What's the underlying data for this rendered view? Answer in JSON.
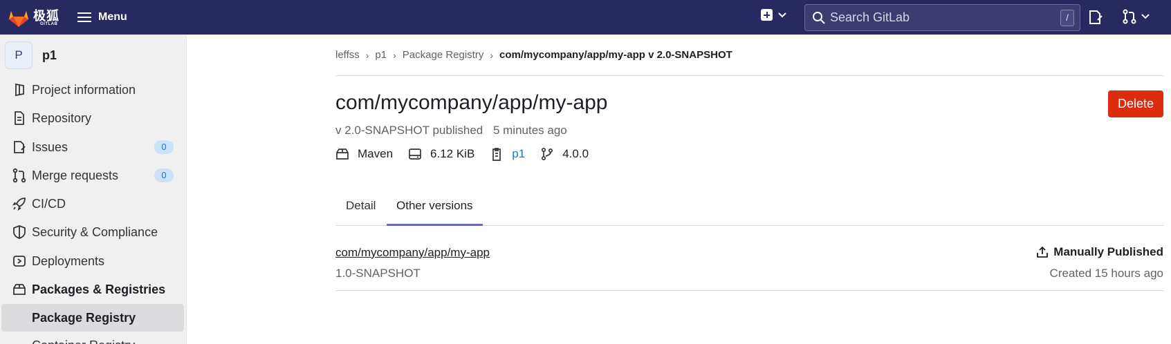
{
  "topbar": {
    "logo_text": "极狐",
    "logo_sub": "GITLAB",
    "menu_label": "Menu",
    "search_placeholder": "Search GitLab",
    "search_shortcut": "/",
    "color": "#292961"
  },
  "sidebar": {
    "project_avatar": "P",
    "project_name": "p1",
    "items": [
      {
        "label": "Project information",
        "icon": "project-icon"
      },
      {
        "label": "Repository",
        "icon": "document-icon"
      },
      {
        "label": "Issues",
        "icon": "issues-icon",
        "badge": "0"
      },
      {
        "label": "Merge requests",
        "icon": "merge-request-icon",
        "badge": "0"
      },
      {
        "label": "CI/CD",
        "icon": "rocket-icon"
      },
      {
        "label": "Security & Compliance",
        "icon": "shield-icon"
      },
      {
        "label": "Deployments",
        "icon": "deployments-icon"
      },
      {
        "label": "Packages & Registries",
        "icon": "package-icon"
      },
      {
        "label": "Package Registry"
      },
      {
        "label": "Container Registry"
      }
    ]
  },
  "breadcrumb": {
    "items": [
      "leffss",
      "p1",
      "Package Registry",
      "com/mycompany/app/my-app v 2.0-SNAPSHOT"
    ]
  },
  "package": {
    "title": "com/mycompany/app/my-app",
    "delete_label": "Delete",
    "version_published": "v 2.0-SNAPSHOT published",
    "time_ago": "5 minutes ago",
    "type": "Maven",
    "size": "6.12 KiB",
    "project": "p1",
    "pipeline_ref": "4.0.0"
  },
  "tabs": {
    "detail": "Detail",
    "other_versions": "Other versions"
  },
  "versions": [
    {
      "name": "com/mycompany/app/my-app",
      "version": "1.0-SNAPSHOT",
      "status": "Manually Published",
      "created": "Created 15 hours ago"
    }
  ],
  "colors": {
    "delete": "#dd2b0e",
    "tab_active": "#6666c4",
    "link": "#1f75cb",
    "badge_bg": "#cbe2f9"
  }
}
